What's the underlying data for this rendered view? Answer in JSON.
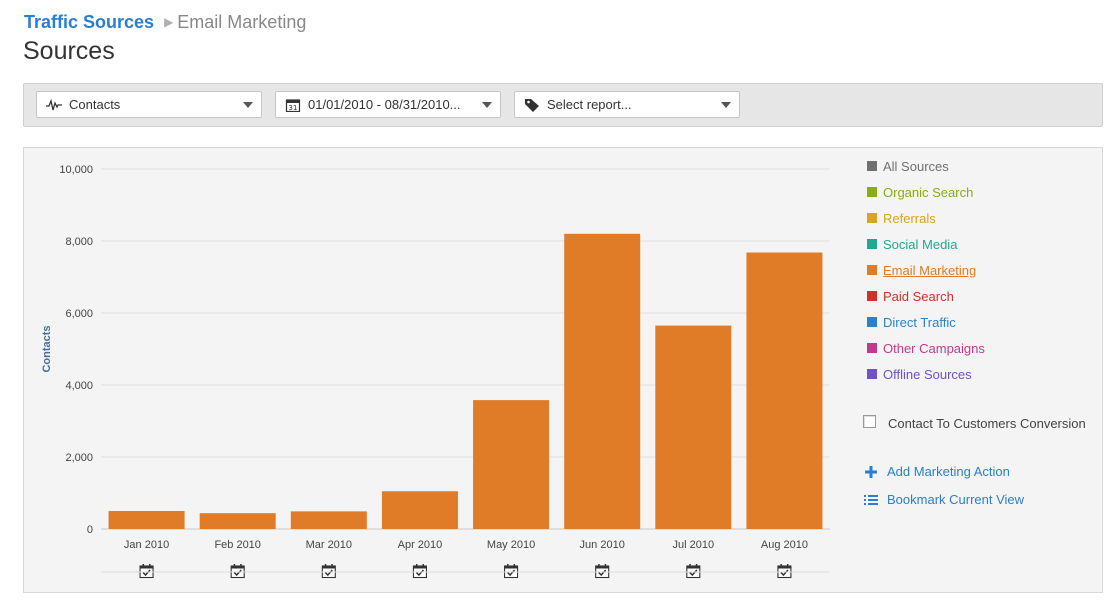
{
  "breadcrumb": {
    "root": "Traffic Sources",
    "separator": "▶",
    "current": "Email Marketing"
  },
  "page_title": "Sources",
  "toolbar": {
    "metric_select": {
      "value": "Contacts",
      "icon": "pulse-icon"
    },
    "date_select": {
      "value": "01/01/2010 - 08/31/2010...",
      "icon": "calendar-icon"
    },
    "report_select": {
      "value": "Select report...",
      "icon": "tag-icon"
    }
  },
  "legend": [
    {
      "label": "All Sources",
      "color": "#707070",
      "active": false
    },
    {
      "label": "Organic Search",
      "color": "#8bab16",
      "active": false
    },
    {
      "label": "Referrals",
      "color": "#d9a51c",
      "active": false
    },
    {
      "label": "Social Media",
      "color": "#21a890",
      "active": false
    },
    {
      "label": "Email Marketing",
      "color": "#e07b28",
      "active": true
    },
    {
      "label": "Paid Search",
      "color": "#d0302c",
      "active": false
    },
    {
      "label": "Direct Traffic",
      "color": "#2a83c9",
      "active": false
    },
    {
      "label": "Other Campaigns",
      "color": "#c03a8c",
      "active": false
    },
    {
      "label": "Offline Sources",
      "color": "#6f52c9",
      "active": false
    }
  ],
  "conversion_toggle": {
    "label": "Contact To Customers Conversion",
    "checked": false
  },
  "actions": [
    {
      "label": "Add Marketing Action",
      "icon": "plus-icon"
    },
    {
      "label": "Bookmark Current View",
      "icon": "list-icon"
    }
  ],
  "chart_data": {
    "type": "bar",
    "title": "",
    "xlabel": "",
    "ylabel": "Contacts",
    "ylim": [
      0,
      10000
    ],
    "yticks": [
      "10,000",
      "8,000",
      "6,000",
      "4,000",
      "2,000",
      "0"
    ],
    "categories": [
      "Jan 2010",
      "Feb 2010",
      "Mar 2010",
      "Apr 2010",
      "May 2010",
      "Jun 2010",
      "Jul 2010",
      "Aug 2010"
    ],
    "series": [
      {
        "name": "Email Marketing",
        "color": "#e07b28",
        "values": [
          500,
          440,
          490,
          1050,
          3580,
          8200,
          5650,
          7680
        ]
      }
    ],
    "grid": true,
    "legend_position": "right",
    "x_marker_icon": "calendar-check-icon"
  }
}
